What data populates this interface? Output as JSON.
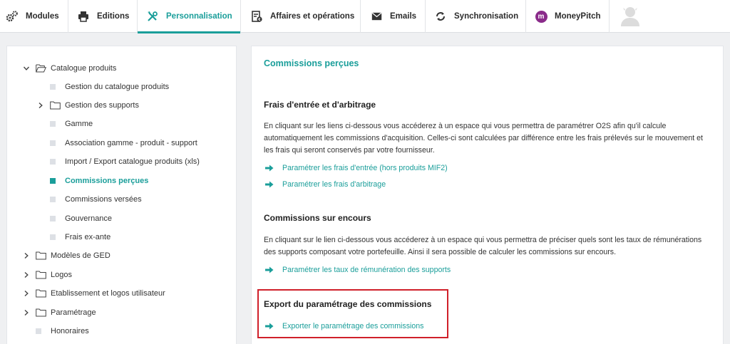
{
  "nav": {
    "tabs": [
      {
        "label": "Modules",
        "icon": "gears-icon"
      },
      {
        "label": "Editions",
        "icon": "printer-icon"
      },
      {
        "label": "Personnalisation",
        "icon": "tools-icon"
      },
      {
        "label": "Affaires et opérations",
        "icon": "document-euro-icon"
      },
      {
        "label": "Emails",
        "icon": "envelope-icon"
      },
      {
        "label": "Synchronisation",
        "icon": "sync-icon"
      },
      {
        "label": "MoneyPitch",
        "icon": "moneypitch-logo-icon",
        "badge": "m"
      }
    ],
    "active": "Personnalisation"
  },
  "colors": {
    "accent": "#1a9e9a",
    "highlight_border": "#d0202a",
    "moneypitch": "#8a2b8a"
  },
  "sidebar": {
    "items": [
      {
        "label": "Catalogue produits",
        "type": "folder",
        "state": "expanded"
      },
      {
        "label": "Gestion du catalogue produits",
        "type": "leaf"
      },
      {
        "label": "Gestion des supports",
        "type": "folder",
        "state": "collapsed"
      },
      {
        "label": "Gamme",
        "type": "leaf"
      },
      {
        "label": "Association gamme - produit - support",
        "type": "leaf"
      },
      {
        "label": "Import / Export catalogue produits (xls)",
        "type": "leaf"
      },
      {
        "label": "Commissions perçues",
        "type": "leaf",
        "active": true
      },
      {
        "label": "Commissions versées",
        "type": "leaf"
      },
      {
        "label": "Gouvernance",
        "type": "leaf"
      },
      {
        "label": "Frais ex-ante",
        "type": "leaf"
      },
      {
        "label": "Modèles de GED",
        "type": "folder",
        "state": "collapsed"
      },
      {
        "label": "Logos",
        "type": "folder",
        "state": "collapsed"
      },
      {
        "label": "Etablissement et logos utilisateur",
        "type": "folder",
        "state": "collapsed"
      },
      {
        "label": "Paramétrage",
        "type": "folder",
        "state": "collapsed"
      },
      {
        "label": "Honoraires",
        "type": "leaf"
      }
    ]
  },
  "main": {
    "title": "Commissions perçues",
    "sections": [
      {
        "heading": "Frais d'entrée et d'arbitrage",
        "text": "En cliquant sur les liens ci-dessous vous accéderez à un espace qui vous permettra de paramétrer O2S afin qu'il calcule automatiquement les commissions d'acquisition. Celles-ci sont calculées par différence entre les frais prélevés sur le mouvement et les frais qui seront conservés par votre fournisseur.",
        "links": [
          "Paramétrer les frais d'entrée (hors produits MIF2)",
          "Paramétrer les frais d'arbitrage"
        ]
      },
      {
        "heading": "Commissions sur encours",
        "text": "En cliquant sur le lien ci-dessous vous accéderez à un espace qui vous permettra de préciser quels sont les taux de rémunérations des supports composant votre portefeuille. Ainsi il sera possible de calculer les commissions sur encours.",
        "links": [
          "Paramétrer les taux de rémunération des supports"
        ]
      },
      {
        "heading": "Export du paramétrage des commissions",
        "text": "",
        "links": [
          "Exporter le paramétrage des commissions"
        ]
      }
    ]
  }
}
